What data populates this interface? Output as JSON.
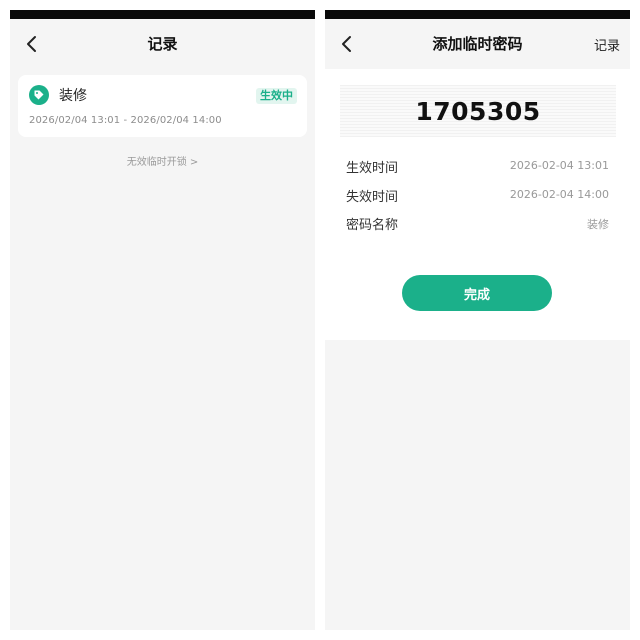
{
  "left": {
    "title": "记录",
    "back_icon": "chevron-left-icon",
    "record": {
      "icon": "tag-icon",
      "name": "装修",
      "status": "生效中",
      "range": "2026/02/04 13:01 - 2026/02/04 14:00"
    },
    "invalid_link": "无效临时开锁  >"
  },
  "right": {
    "title": "添加临时密码",
    "back_icon": "chevron-left-icon",
    "records_link": "记录",
    "code": "1705305",
    "rows": [
      {
        "label": "生效时间",
        "value": "2026-02-04 13:01"
      },
      {
        "label": "失效时间",
        "value": "2026-02-04 14:00"
      },
      {
        "label": "密码名称",
        "value": "装修"
      }
    ],
    "done_label": "完成"
  },
  "colors": {
    "accent": "#1bb08a",
    "badge_bg": "#e2f5ef",
    "page_bg": "#f5f5f5",
    "status_bar": "#0a0a0a"
  }
}
